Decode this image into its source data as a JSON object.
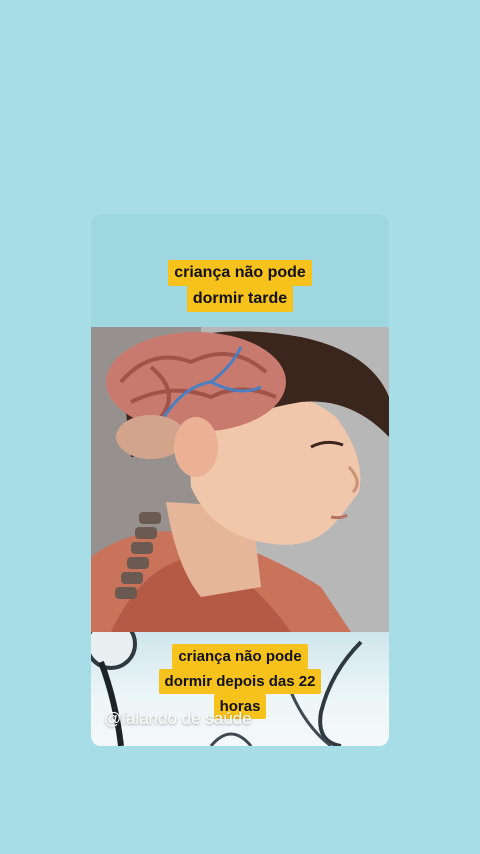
{
  "caption_top_lines": [
    "criança não pode",
    "dormir tarde"
  ],
  "caption_bottom_lines": [
    "criança não pode",
    "dormir depois das 22",
    "horas"
  ],
  "watermark": "@falando de saúde",
  "colors": {
    "background": "#a6dde6",
    "caption_highlight": "#f7c21b"
  }
}
